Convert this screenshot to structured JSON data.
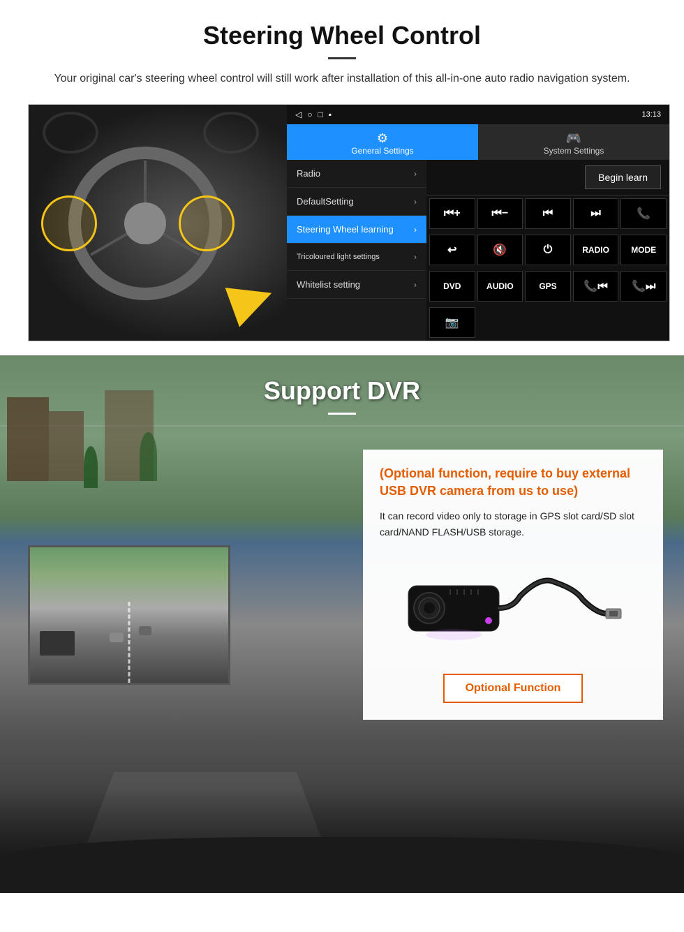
{
  "steering": {
    "title": "Steering Wheel Control",
    "subtitle": "Your original car's steering wheel control will still work after installation of this all-in-one auto radio navigation system.",
    "tabs": {
      "general": "General Settings",
      "system": "System Settings",
      "general_icon": "⚙",
      "system_icon": "🎮"
    },
    "menu": [
      {
        "label": "Radio",
        "active": false
      },
      {
        "label": "DefaultSetting",
        "active": false
      },
      {
        "label": "Steering Wheel learning",
        "active": true
      },
      {
        "label": "Tricoloured light settings",
        "active": false
      },
      {
        "label": "Whitelist setting",
        "active": false
      }
    ],
    "begin_learn": "Begin learn",
    "status_time": "13:13",
    "controls": {
      "row1": [
        "⏮+",
        "⏮−",
        "⏮⏮",
        "⏭⏭",
        "📞"
      ],
      "row2": [
        "↩",
        "🔇",
        "⏻",
        "RADIO",
        "MODE"
      ],
      "row3": [
        "DVD",
        "AUDIO",
        "GPS",
        "📞⏮",
        "📞⏭"
      ],
      "row4": [
        "📷"
      ]
    }
  },
  "dvr": {
    "title": "Support DVR",
    "optional_text": "(Optional function, require to buy external USB DVR camera from us to use)",
    "description": "It can record video only to storage in GPS slot card/SD slot card/NAND FLASH/USB storage.",
    "optional_function_btn": "Optional Function"
  }
}
